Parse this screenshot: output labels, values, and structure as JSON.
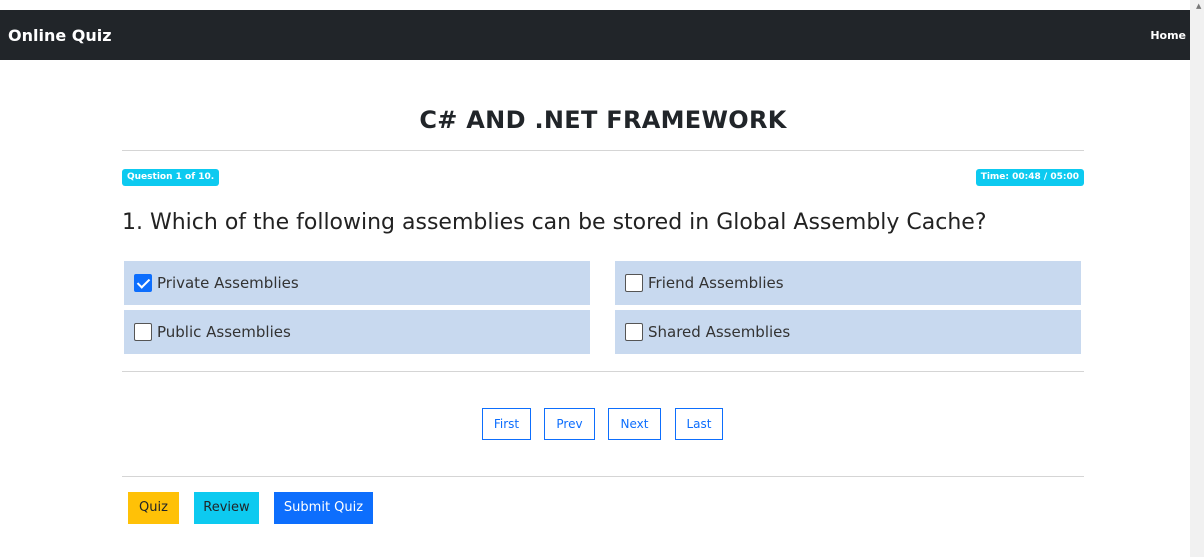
{
  "navbar": {
    "brand": "Online Quiz",
    "home": "Home"
  },
  "quiz": {
    "title": "C# AND .NET FRAMEWORK",
    "question_counter": "Question 1 of 10.",
    "timer": "Time: 00:48 / 05:00",
    "question_text": "1. Which of the following assemblies can be stored in Global Assembly Cache?",
    "options": [
      {
        "label": "Private Assemblies",
        "checked": true
      },
      {
        "label": "Friend Assemblies",
        "checked": false
      },
      {
        "label": "Public Assemblies",
        "checked": false
      },
      {
        "label": "Shared Assemblies",
        "checked": false
      }
    ]
  },
  "pagination": {
    "first": "First",
    "prev": "Prev",
    "next": "Next",
    "last": "Last"
  },
  "actions": {
    "quiz": "Quiz",
    "review": "Review",
    "submit": "Submit Quiz"
  },
  "colors": {
    "navbar": "#212529",
    "info": "#0dcaf0",
    "primary": "#0d6efd",
    "warning": "#ffc107",
    "option_bg": "#c8d9ef"
  }
}
